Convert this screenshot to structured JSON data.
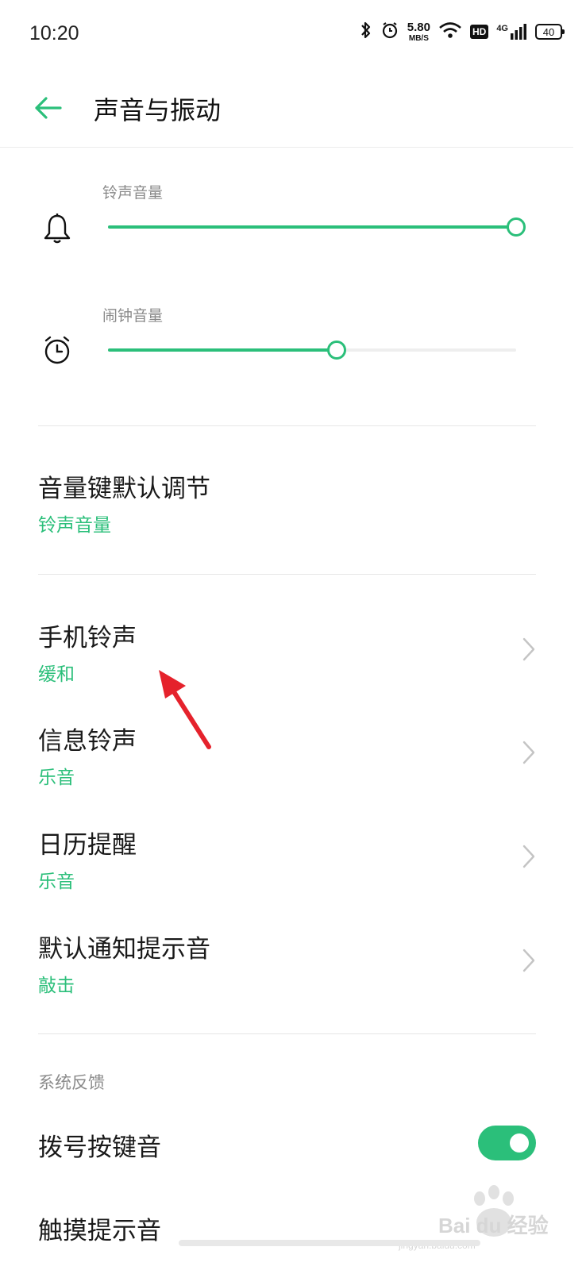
{
  "status_bar": {
    "time": "10:20",
    "net_speed": "5.80",
    "net_speed_unit": "MB/S",
    "hd": "HD",
    "network": "4G",
    "battery": "40"
  },
  "header": {
    "title": "声音与振动"
  },
  "sliders": [
    {
      "label": "铃声音量",
      "icon": "bell-icon",
      "level": 1.0
    },
    {
      "label": "闹钟音量",
      "icon": "alarm-clock-icon",
      "level": 0.56
    }
  ],
  "volume_key": {
    "title": "音量键默认调节",
    "value": "铃声音量"
  },
  "ringtones": [
    {
      "title": "手机铃声",
      "value": "缓和"
    },
    {
      "title": "信息铃声",
      "value": "乐音"
    },
    {
      "title": "日历提醒",
      "value": "乐音"
    },
    {
      "title": "默认通知提示音",
      "value": "敲击"
    }
  ],
  "system_feedback": {
    "header": "系统反馈",
    "items": [
      {
        "title": "拨号按键音",
        "toggle_on": true
      },
      {
        "title": "触摸提示音"
      }
    ]
  },
  "watermark": {
    "text": "Bai du 经验",
    "sub": "jingyan.baidu.com"
  },
  "colors": {
    "accent": "#2bbf7a",
    "annotation": "#e5222c"
  }
}
